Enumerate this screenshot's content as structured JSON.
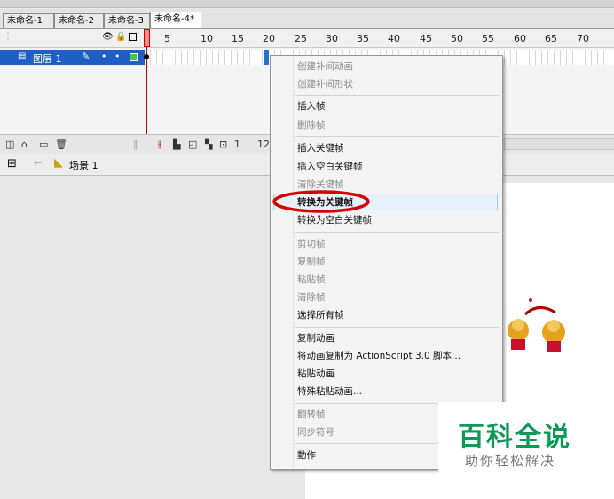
{
  "tabs": [
    "未命名-1",
    "未命名-2",
    "未命名-3",
    "未命名-4*"
  ],
  "ruler": [
    "5",
    "10",
    "15",
    "20",
    "25",
    "30",
    "35",
    "40",
    "45",
    "50",
    "55",
    "60",
    "65",
    "70"
  ],
  "layer": {
    "name": "图层 1"
  },
  "timeline_footer": {
    "frame": "1",
    "fps": "12"
  },
  "scene": {
    "name": "场景 1"
  },
  "menu": {
    "items": [
      {
        "label": "创建补间动画",
        "enabled": false
      },
      {
        "label": "创建补间形状",
        "enabled": false
      },
      {
        "label": "插入帧",
        "enabled": true
      },
      {
        "label": "删除帧",
        "enabled": false
      },
      {
        "label": "插入关键帧",
        "enabled": true
      },
      {
        "label": "插入空白关键帧",
        "enabled": true
      },
      {
        "label": "清除关键帧",
        "enabled": false
      },
      {
        "label": "转换为关键帧",
        "enabled": true,
        "highlighted": true
      },
      {
        "label": "转换为空白关键帧",
        "enabled": true
      },
      {
        "label": "剪切帧",
        "enabled": false
      },
      {
        "label": "复制帧",
        "enabled": false
      },
      {
        "label": "粘贴帧",
        "enabled": false
      },
      {
        "label": "清除帧",
        "enabled": false
      },
      {
        "label": "选择所有帧",
        "enabled": true
      },
      {
        "label": "复制动画",
        "enabled": true
      },
      {
        "label": "将动画复制为 ActionScript 3.0 脚本...",
        "enabled": true
      },
      {
        "label": "粘贴动画",
        "enabled": true
      },
      {
        "label": "特殊粘贴动画...",
        "enabled": true
      },
      {
        "label": "翻转帧",
        "enabled": false
      },
      {
        "label": "同步符号",
        "enabled": false
      },
      {
        "label": "動作",
        "enabled": true
      }
    ]
  },
  "watermark": {
    "title": "百科全说",
    "subtitle": "助你轻松解决"
  },
  "colors": {
    "accent_green": "#0d9a57",
    "selection": "#1e5ec5",
    "playhead": "#cc0000",
    "annotation_red": "#d40000"
  }
}
